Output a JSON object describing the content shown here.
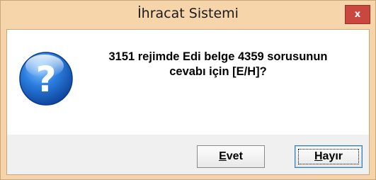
{
  "window": {
    "title": "İhracat Sistemi",
    "close_label": "x"
  },
  "dialog": {
    "icon": "question-icon",
    "message_line1": "3151 rejimde Edi belge 4359 sorusunun",
    "message_line2": "cevabı için  [E/H]?"
  },
  "buttons": {
    "yes": {
      "mnemonic": "E",
      "rest": "vet"
    },
    "no": {
      "mnemonic": "H",
      "rest": "ayır"
    }
  },
  "colors": {
    "title_bar": "#f7d5ab",
    "close_button": "#c9473f",
    "icon_blue": "#1c69c7"
  }
}
